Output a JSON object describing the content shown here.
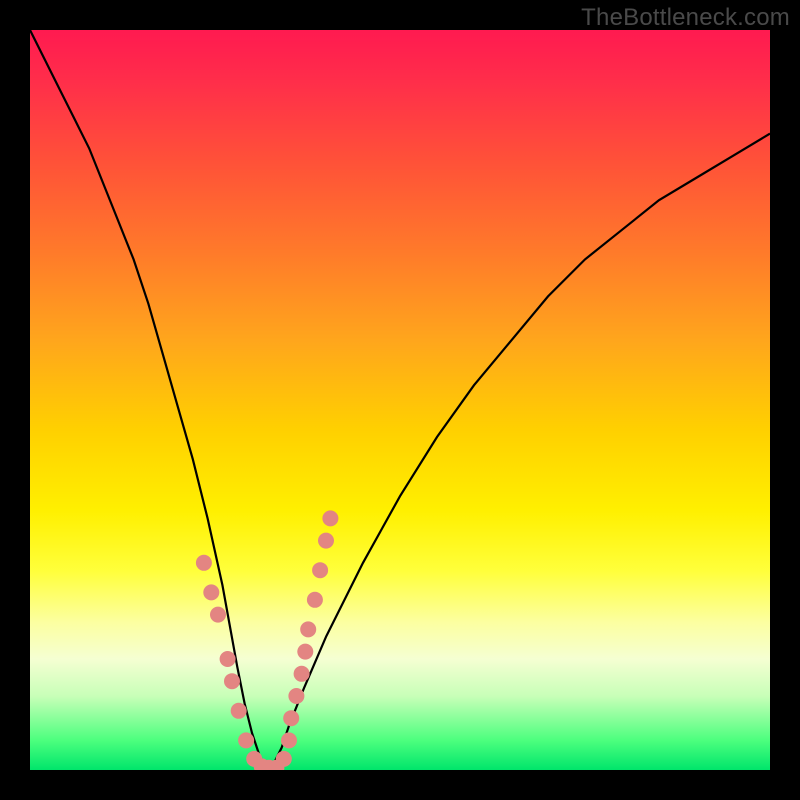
{
  "watermark": "TheBottleneck.com",
  "colors": {
    "curve": "#000000",
    "dots": "#e38582",
    "background_frame": "#000000"
  },
  "chart_data": {
    "type": "line",
    "title": "",
    "xlabel": "",
    "ylabel": "",
    "xlim": [
      0,
      100
    ],
    "ylim": [
      0,
      100
    ],
    "grid": false,
    "legend": false,
    "description": "Bottleneck-style V curve over a vertical red→green gradient. Y encodes bottleneck percentage (top = high bottleneck / red, bottom = 0% / green). X is a parameter sweep. Minimum sits near x≈32, y≈0. Salmon bead-like markers cluster on both arms of the V near the bottom.",
    "series": [
      {
        "name": "bottleneck-curve",
        "x": [
          0,
          2,
          4,
          6,
          8,
          10,
          12,
          14,
          16,
          18,
          20,
          22,
          24,
          26,
          28,
          29,
          30,
          31,
          32,
          33,
          34,
          35,
          37,
          40,
          45,
          50,
          55,
          60,
          65,
          70,
          75,
          80,
          85,
          90,
          95,
          100
        ],
        "y": [
          100,
          96,
          92,
          88,
          84,
          79,
          74,
          69,
          63,
          56,
          49,
          42,
          34,
          25,
          14,
          9,
          5,
          2,
          0,
          1,
          3,
          6,
          11,
          18,
          28,
          37,
          45,
          52,
          58,
          64,
          69,
          73,
          77,
          80,
          83,
          86
        ]
      }
    ],
    "markers": [
      {
        "x": 23.5,
        "y": 28
      },
      {
        "x": 24.5,
        "y": 24
      },
      {
        "x": 25.4,
        "y": 21
      },
      {
        "x": 26.7,
        "y": 15
      },
      {
        "x": 27.3,
        "y": 12
      },
      {
        "x": 28.2,
        "y": 8
      },
      {
        "x": 29.2,
        "y": 4
      },
      {
        "x": 30.3,
        "y": 1.5
      },
      {
        "x": 31.3,
        "y": 0.5
      },
      {
        "x": 32.3,
        "y": 0.3
      },
      {
        "x": 33.3,
        "y": 0.3
      },
      {
        "x": 34.3,
        "y": 1.5
      },
      {
        "x": 35.0,
        "y": 4
      },
      {
        "x": 35.3,
        "y": 7
      },
      {
        "x": 36.0,
        "y": 10
      },
      {
        "x": 36.7,
        "y": 13
      },
      {
        "x": 37.2,
        "y": 16
      },
      {
        "x": 37.6,
        "y": 19
      },
      {
        "x": 38.5,
        "y": 23
      },
      {
        "x": 39.2,
        "y": 27
      },
      {
        "x": 40.0,
        "y": 31
      },
      {
        "x": 40.6,
        "y": 34
      }
    ]
  }
}
